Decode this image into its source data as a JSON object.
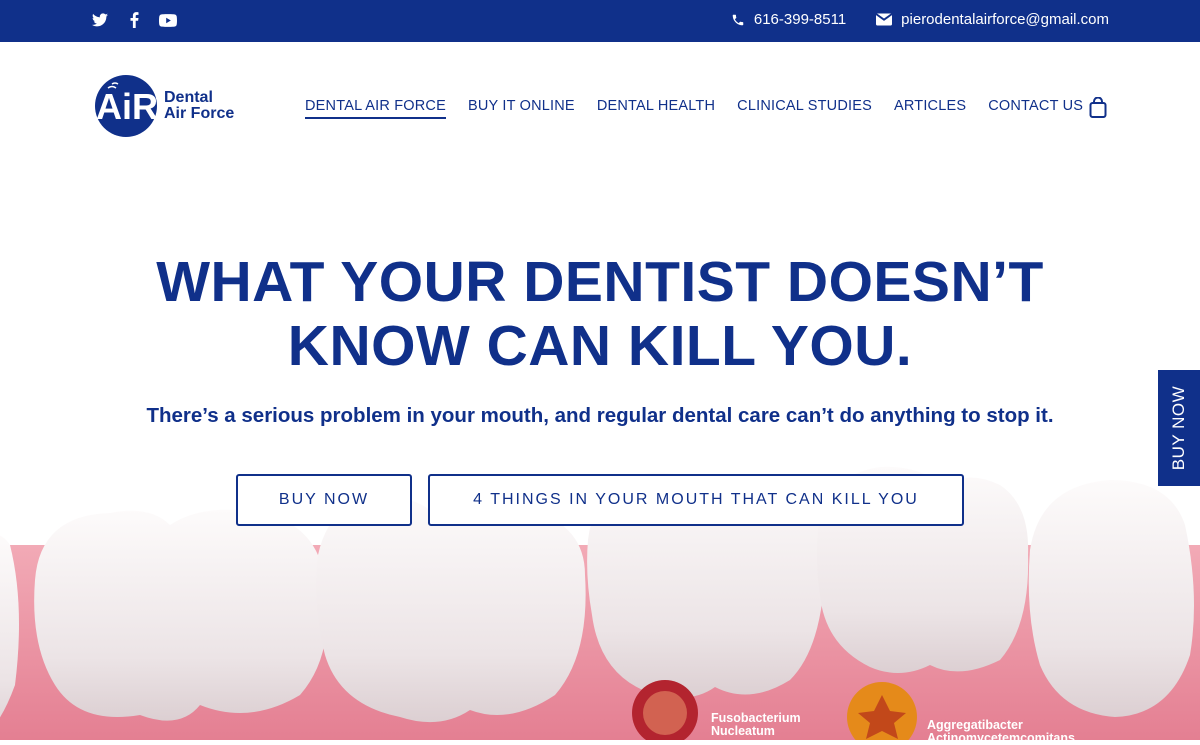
{
  "topbar": {
    "social": [
      {
        "icon": "twitter-icon"
      },
      {
        "icon": "facebook-icon"
      },
      {
        "icon": "youtube-icon"
      }
    ],
    "phone": "616-399-8511",
    "email": "pierodentalairforce@gmail.com"
  },
  "header": {
    "logo_mark": "AiR",
    "logo_line1": "Dental",
    "logo_line2": "Air Force",
    "nav": [
      {
        "label": "DENTAL AIR FORCE",
        "active": true
      },
      {
        "label": "BUY IT ONLINE"
      },
      {
        "label": "DENTAL HEALTH"
      },
      {
        "label": "CLINICAL STUDIES"
      },
      {
        "label": "ARTICLES"
      },
      {
        "label": "CONTACT US"
      }
    ],
    "cart_icon": "shopping-bag-icon"
  },
  "hero": {
    "title_line1": "WHAT YOUR DENTIST DOESN’T",
    "title_line2": "KNOW CAN KILL YOU.",
    "subtitle": "There’s a serious problem in your mouth, and regular dental care can’t do anything to stop it.",
    "buttons": {
      "buy": "BUY NOW",
      "four_things": "4 THINGS IN YOUR MOUTH THAT CAN KILL YOU"
    },
    "bacteria": [
      {
        "line1": "Fusobacterium",
        "line2": "Nucleatum"
      },
      {
        "line1": "Aggregatibacter",
        "line2": "Actinomycetemcomitans"
      }
    ]
  },
  "side_tab": {
    "label": "BUY NOW"
  },
  "colors": {
    "brand": "#10308a",
    "gum": "#ee9aa9",
    "tooth": "#f7f3f3"
  }
}
